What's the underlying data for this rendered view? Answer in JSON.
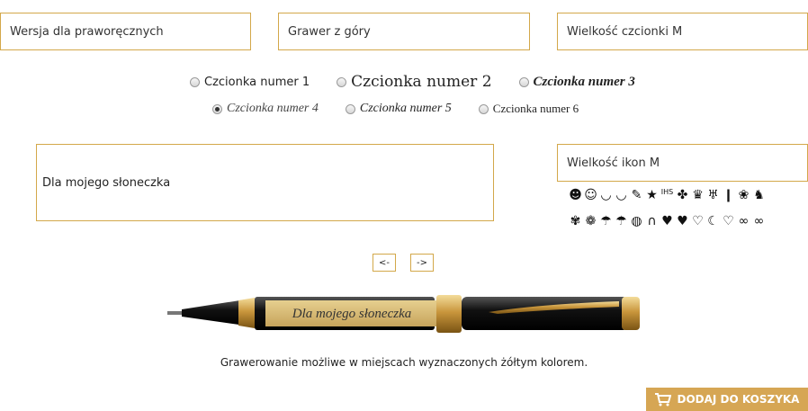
{
  "selects": {
    "hand": "Wersja dla praworęcznych",
    "engrave_position": "Grawer z góry",
    "font_size": "Wielkość czcionki M",
    "icon_size": "Wielkość ikon M"
  },
  "fonts": [
    {
      "label": "Czcionka numer 1",
      "selected": false
    },
    {
      "label": "Czcionka numer 2",
      "selected": false
    },
    {
      "label": "Czcionka numer 3",
      "selected": false
    },
    {
      "label": "Czcionka numer 4",
      "selected": true
    },
    {
      "label": "Czcionka numer 5",
      "selected": false
    },
    {
      "label": "Czcionka numer 6",
      "selected": false
    }
  ],
  "engraving_text": "Dla mojego słoneczka",
  "icons_row1": [
    "☻",
    "☺",
    "◡",
    "◡",
    "✎",
    "★",
    "IHS",
    "✤",
    "♛",
    "♅",
    "❙",
    "❀",
    "♞"
  ],
  "icons_row2": [
    "✾",
    "❁",
    "☂",
    "☂",
    "◍",
    "∩",
    "♥",
    "♥",
    "♡",
    "☾",
    "♡",
    "∞",
    "∞"
  ],
  "nav": {
    "prev": "<-",
    "next": "->"
  },
  "preview_text": "Dla mojego słoneczka",
  "note": "Grawerowanie możliwe w miejscach wyznaczonych żółtym kolorem.",
  "cart_button": "DODAJ DO KOSZYKA",
  "colors": {
    "accent": "#d3a84a",
    "button": "#d6a654"
  }
}
